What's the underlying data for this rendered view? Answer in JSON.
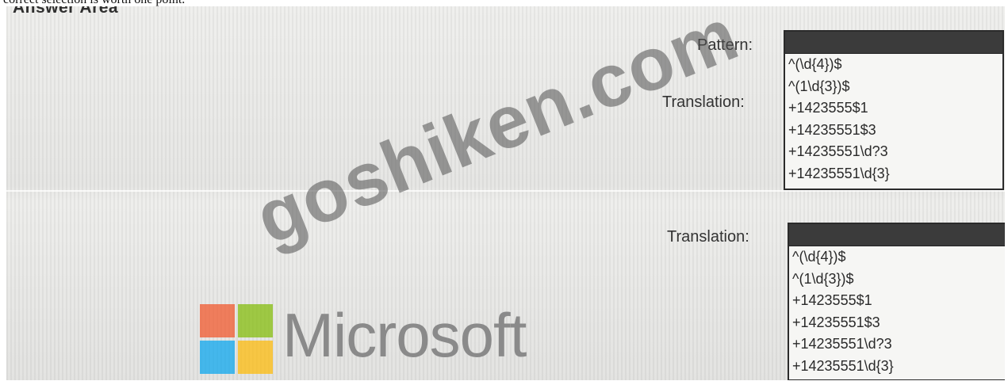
{
  "header": {
    "caption": "correct selection is worth one point.",
    "answer_area": "Answer Area"
  },
  "dropdown1": {
    "label_pattern": "Pattern:",
    "label_translation": "Translation:",
    "options": [
      "^(\\d{4})$",
      "^(1\\d{3})$",
      "+1423555$1",
      "+14235551$3",
      "+14235551\\d?3",
      "+14235551\\d{3}"
    ]
  },
  "dropdown2": {
    "label": "Translation:",
    "options": [
      "^(\\d{4})$",
      "^(1\\d{3})$",
      "+1423555$1",
      "+14235551$3",
      "+14235551\\d?3",
      "+14235551\\d{3}"
    ]
  },
  "watermark": "goshiken.com",
  "logo": {
    "text": "Microsoft",
    "colors": [
      "#f25022",
      "#7fba00",
      "#00a4ef",
      "#ffb900"
    ]
  }
}
